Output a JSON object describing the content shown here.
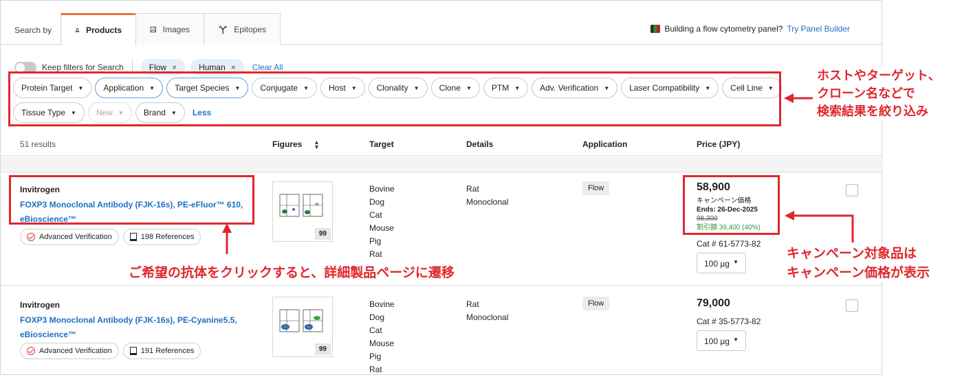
{
  "tabs": {
    "search_by": "Search by",
    "products": "Products",
    "images": "Images",
    "epitopes": "Epitopes",
    "promo_text": "Building a flow cytometry panel?",
    "promo_link": "Try Panel Builder"
  },
  "filters": {
    "keep_label": "Keep filters for Search",
    "active_tags": [
      "Flow",
      "Human"
    ],
    "tag_remove": "×",
    "clear_all": "Clear All",
    "row1": [
      "Protein Target",
      "Application",
      "Target Species",
      "Conjugate",
      "Host",
      "Clonality",
      "Clone",
      "PTM",
      "Adv. Verification",
      "Laser Compatibility",
      "Cell Line"
    ],
    "row2": [
      "Tissue Type",
      "New",
      "Brand"
    ],
    "less": "Less"
  },
  "table": {
    "count": "51 results",
    "col_figures": "Figures",
    "col_target": "Target",
    "col_details": "Details",
    "col_application": "Application",
    "col_price": "Price (JPY)"
  },
  "products": [
    {
      "brand": "Invitrogen",
      "name": "FOXP3 Monoclonal Antibody (FJK-16s), PE-eFluor™ 610, eBioscience™",
      "verification": "Advanced Verification",
      "references": "198 References",
      "figures": "99",
      "targets": [
        "Bovine",
        "Dog",
        "Cat",
        "Mouse",
        "Pig",
        "Rat"
      ],
      "details": [
        "Rat",
        "Monoclonal"
      ],
      "application": "Flow",
      "price": "58,900",
      "campaign_label": "キャンペーン価格",
      "ends": "Ends: 26-Dec-2025",
      "old_price": "98,300",
      "discount": "割引額 39,400 (40%)",
      "cat": "Cat # 61-5773-82",
      "qty": "100 µg"
    },
    {
      "brand": "Invitrogen",
      "name": "FOXP3 Monoclonal Antibody (FJK-16s), PE-Cyanine5.5, eBioscience™",
      "verification": "Advanced Verification",
      "references": "191 References",
      "figures": "99",
      "targets": [
        "Bovine",
        "Dog",
        "Cat",
        "Mouse",
        "Pig",
        "Rat"
      ],
      "details": [
        "Rat",
        "Monoclonal"
      ],
      "application": "Flow",
      "price": "79,000",
      "cat": "Cat # 35-5773-82",
      "qty": "100 µg"
    }
  ],
  "annotations": {
    "filter_note": [
      "ホストやターゲット、",
      "クローン名などで",
      "検索結果を絞り込み"
    ],
    "click_note": "ご希望の抗体をクリックすると、詳細製品ページに遷移",
    "campaign_note": [
      "キャンペーン対象品は",
      "キャンペーン価格が表示"
    ]
  },
  "colors": {
    "accent": "#e0262b",
    "link": "#1d6fc4",
    "tab_active": "#e8773f",
    "discount": "#2a9a3a"
  }
}
